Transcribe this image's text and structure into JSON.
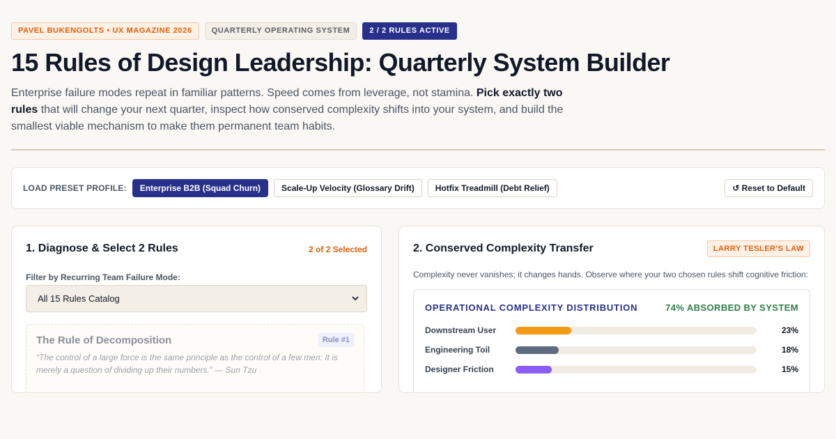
{
  "header": {
    "badges": [
      "PAVEL BUKENGOLTS • UX MAGAZINE 2026",
      "QUARTERLY OPERATING SYSTEM",
      "2 / 2 RULES ACTIVE"
    ],
    "title": "15 Rules of Design Leadership: Quarterly System Builder",
    "intro_pre": "Enterprise failure modes repeat in familiar patterns. Speed comes from leverage, not stamina. ",
    "intro_bold": "Pick exactly two rules",
    "intro_post": " that will change your next quarter, inspect how conserved complexity shifts into your system, and build the smallest viable mechanism to make them permanent team habits."
  },
  "presets": {
    "label": "LOAD PRESET PROFILE:",
    "options": [
      "Enterprise B2B (Squad Churn)",
      "Scale-Up Velocity (Glossary Drift)",
      "Hotfix Treadmill (Debt Relief)"
    ],
    "active_index": 0,
    "reset_label": "↺ Reset to Default"
  },
  "diagnose": {
    "title": "1. Diagnose & Select 2 Rules",
    "selected_count": "2 of 2 Selected",
    "filter_label": "Filter by Recurring Team Failure Mode:",
    "filter_value": "All 15 Rules Catalog",
    "rule": {
      "title": "The Rule of Decomposition",
      "tag": "Rule #1",
      "quote": "“The control of a large force is the same principle as the control of a few men: It is merely a question of dividing up their numbers.” — Sun Tzu"
    }
  },
  "complexity": {
    "title": "2. Conserved Complexity Transfer",
    "law": "LARRY TESLER'S LAW",
    "desc": "Complexity never vanishes; it changes hands. Observe where your two chosen rules shift cognitive friction:",
    "panel_title": "OPERATIONAL COMPLEXITY DISTRIBUTION",
    "absorbed": "74% ABSORBED BY SYSTEM",
    "rows": [
      {
        "label": "Downstream User",
        "value": 23,
        "pct": "23%",
        "color": "#f29a13"
      },
      {
        "label": "Engineering Toil",
        "value": 18,
        "pct": "18%",
        "color": "#5f6b7f"
      },
      {
        "label": "Designer Friction",
        "value": 15,
        "pct": "15%",
        "color": "#8b5cf6"
      }
    ]
  }
}
